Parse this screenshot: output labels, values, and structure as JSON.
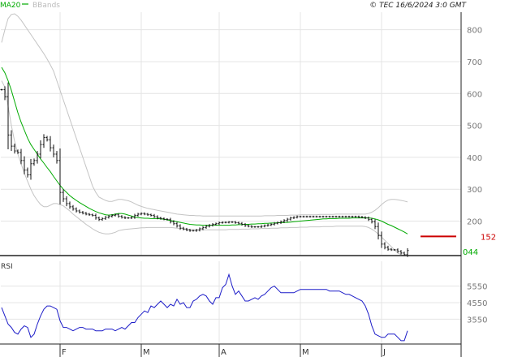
{
  "header": {
    "legend": [
      {
        "label": "MA20",
        "color": "#00aa00"
      },
      {
        "label": "BBands",
        "color": "#bbbbbb"
      }
    ],
    "copyright": "© TEC 16/6/2024 3:0 GMT"
  },
  "colors": {
    "price": "#111111",
    "ma": "#00aa00",
    "bands": "#c4c4c4",
    "rsi": "#1c1cc8",
    "marker": "#cc0000",
    "grid": "#e4e4e4",
    "axis_text": "#777777",
    "last_text": "#cc0000"
  },
  "chart_data": [
    {
      "type": "line",
      "name": "price-panel",
      "y_ticks": [
        {
          "value": 800,
          "label": "800"
        },
        {
          "value": 700,
          "label": "700"
        },
        {
          "value": 600,
          "label": "600"
        },
        {
          "value": 500,
          "label": "500"
        },
        {
          "value": 400,
          "label": "400"
        },
        {
          "value": 300,
          "label": "300"
        },
        {
          "value": 200,
          "label": "200"
        }
      ],
      "ylim": [
        92,
        855
      ],
      "x_ticks": [
        {
          "index": 18,
          "label": "F"
        },
        {
          "index": 43,
          "label": "M"
        },
        {
          "index": 67,
          "label": "A"
        },
        {
          "index": 92,
          "label": "M"
        },
        {
          "index": 117,
          "label": "J"
        }
      ],
      "current_value": 152,
      "current_label": "152",
      "min_label": "044",
      "price": [
        612,
        590,
        470,
        435,
        420,
        415,
        390,
        360,
        345,
        380,
        390,
        410,
        440,
        462,
        455,
        430,
        410,
        390,
        290,
        270,
        255,
        245,
        238,
        232,
        228,
        225,
        222,
        220,
        218,
        210,
        205,
        208,
        212,
        215,
        218,
        220,
        215,
        212,
        210,
        210,
        212,
        218,
        222,
        224,
        222,
        220,
        218,
        214,
        210,
        208,
        206,
        205,
        198,
        192,
        185,
        178,
        175,
        172,
        170,
        170,
        172,
        176,
        180,
        184,
        187,
        190,
        192,
        195,
        196,
        196,
        197,
        197,
        195,
        193,
        190,
        186,
        184,
        182,
        182,
        182,
        184,
        186,
        188,
        190,
        193,
        195,
        198,
        202,
        206,
        210,
        212,
        214,
        214,
        214,
        214,
        214,
        214,
        214,
        214,
        214,
        214,
        214,
        214,
        214,
        214,
        214,
        214,
        214,
        214,
        214,
        213,
        212,
        210,
        205,
        198,
        183,
        155,
        128,
        118,
        112,
        110,
        110,
        105,
        100,
        95,
        108
      ],
      "ma20": [
        682,
        665,
        640,
        610,
        575,
        540,
        510,
        485,
        460,
        440,
        425,
        410,
        395,
        382,
        368,
        355,
        340,
        326,
        312,
        300,
        290,
        280,
        272,
        265,
        258,
        252,
        246,
        240,
        235,
        230,
        226,
        223,
        220,
        219,
        220,
        222,
        224,
        224,
        222,
        219,
        216,
        213,
        211,
        210,
        209,
        209,
        208,
        208,
        208,
        207,
        206,
        204,
        202,
        200,
        198,
        196,
        194,
        192,
        190,
        189,
        188,
        188,
        187,
        187,
        187,
        187,
        187,
        187,
        187,
        187,
        187,
        188,
        188,
        189,
        189,
        190,
        190,
        191,
        191,
        192,
        192,
        193,
        193,
        194,
        194,
        195,
        195,
        196,
        196,
        197,
        198,
        199,
        200,
        201,
        202,
        203,
        204,
        205,
        206,
        207,
        207,
        208,
        208,
        208,
        209,
        209,
        209,
        209,
        210,
        210,
        210,
        210,
        210,
        210,
        209,
        207,
        204,
        200,
        195,
        190,
        186,
        181,
        176,
        171,
        166,
        160
      ],
      "bb_upper": [
        760,
        800,
        835,
        848,
        850,
        842,
        830,
        815,
        800,
        785,
        770,
        755,
        740,
        725,
        708,
        690,
        670,
        640,
        610,
        580,
        550,
        520,
        490,
        460,
        430,
        400,
        370,
        340,
        310,
        290,
        275,
        270,
        265,
        262,
        262,
        265,
        268,
        268,
        266,
        264,
        260,
        255,
        250,
        246,
        243,
        240,
        238,
        236,
        234,
        232,
        230,
        228,
        226,
        224,
        222,
        221,
        220,
        219,
        218,
        218,
        217,
        217,
        216,
        216,
        216,
        216,
        216,
        216,
        216,
        216,
        216,
        216,
        216,
        216,
        216,
        216,
        216,
        216,
        216,
        216,
        216,
        217,
        217,
        217,
        217,
        218,
        218,
        218,
        218,
        219,
        219,
        219,
        220,
        220,
        220,
        220,
        220,
        220,
        221,
        221,
        221,
        221,
        221,
        222,
        222,
        222,
        222,
        222,
        222,
        222,
        222,
        222,
        222,
        224,
        228,
        234,
        242,
        252,
        260,
        266,
        268,
        268,
        267,
        265,
        263,
        260
      ],
      "bb_lower": [
        640,
        620,
        560,
        500,
        450,
        410,
        380,
        350,
        325,
        300,
        280,
        265,
        252,
        245,
        245,
        250,
        255,
        255,
        252,
        248,
        240,
        232,
        222,
        214,
        206,
        198,
        190,
        183,
        176,
        170,
        165,
        162,
        160,
        160,
        162,
        165,
        170,
        172,
        174,
        175,
        176,
        177,
        178,
        179,
        179,
        180,
        180,
        180,
        180,
        180,
        180,
        180,
        180,
        179,
        178,
        177,
        176,
        175,
        174,
        174,
        173,
        173,
        173,
        173,
        173,
        173,
        173,
        173,
        173,
        173,
        174,
        174,
        174,
        174,
        175,
        175,
        175,
        176,
        176,
        176,
        177,
        177,
        177,
        178,
        178,
        178,
        179,
        179,
        179,
        180,
        180,
        180,
        181,
        181,
        181,
        182,
        182,
        182,
        182,
        183,
        183,
        183,
        183,
        184,
        184,
        184,
        184,
        184,
        184,
        184,
        184,
        184,
        183,
        180,
        175,
        168,
        160,
        150,
        140,
        130,
        120,
        110,
        100,
        95,
        92,
        92
      ]
    },
    {
      "type": "line",
      "name": "rsi-panel",
      "title": "RSI",
      "y_ticks": [
        {
          "value": 55,
          "label": "5550"
        },
        {
          "value": 45,
          "label": "4550"
        },
        {
          "value": 35,
          "label": "3550"
        }
      ],
      "ylim": [
        20,
        70
      ],
      "rsi": [
        42,
        37,
        32,
        30,
        27,
        26,
        29,
        31,
        30,
        24,
        26,
        32,
        37,
        41,
        43,
        43,
        42,
        41,
        34,
        30,
        30,
        29,
        28,
        29,
        30,
        30,
        29,
        29,
        29,
        28,
        28,
        28,
        29,
        29,
        29,
        28,
        29,
        30,
        29,
        31,
        33,
        33,
        36,
        38,
        40,
        39,
        43,
        42,
        44,
        46,
        44,
        42,
        44,
        43,
        47,
        44,
        45,
        42,
        42,
        46,
        47,
        49,
        50,
        49,
        46,
        44,
        48,
        48,
        54,
        56,
        62,
        55,
        50,
        52,
        49,
        46,
        46,
        47,
        48,
        47,
        49,
        50,
        52,
        54,
        55,
        53,
        51,
        51,
        51,
        51,
        51,
        52,
        53,
        53,
        53,
        53,
        53,
        53,
        53,
        53,
        53,
        52,
        52,
        52,
        52,
        51,
        50,
        50,
        49,
        48,
        47,
        46,
        43,
        38,
        31,
        26,
        25,
        24,
        24,
        26,
        26,
        26,
        24,
        22,
        22,
        28
      ]
    }
  ]
}
